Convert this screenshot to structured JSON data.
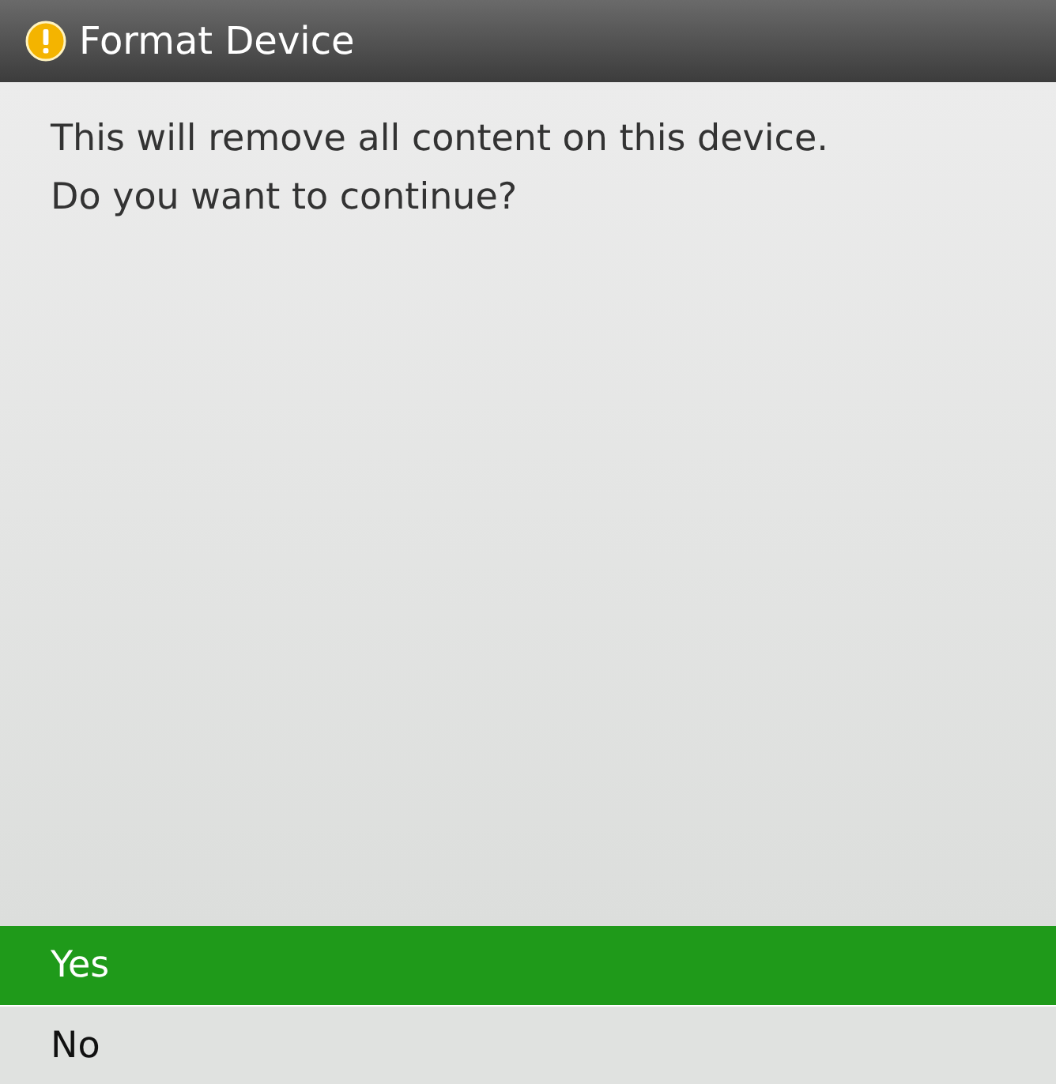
{
  "window": {
    "title": "Format Device"
  },
  "message": [
    "This will remove all content on this device.",
    "Do you want to continue?"
  ],
  "options": [
    {
      "label": "Yes",
      "selected": true
    },
    {
      "label": "No",
      "selected": false
    }
  ]
}
